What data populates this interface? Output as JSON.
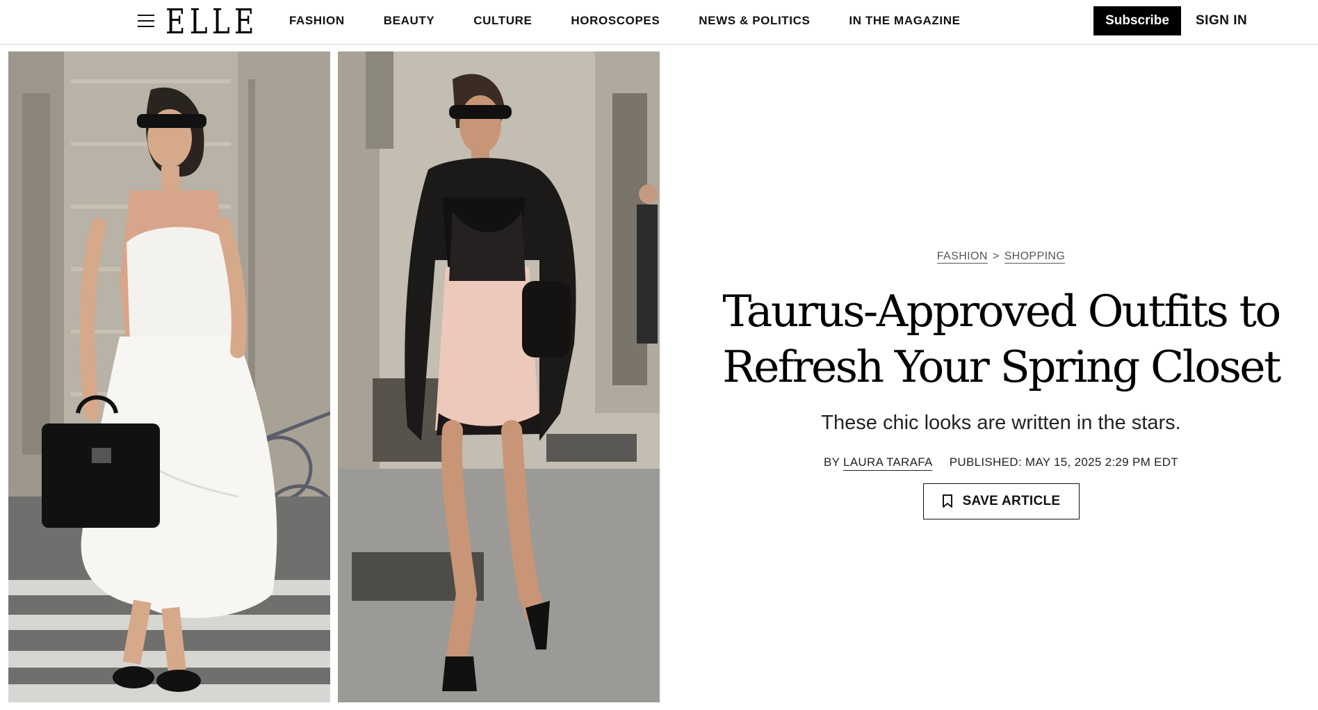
{
  "header": {
    "logo": "ELLE",
    "menu_icon": "hamburger-menu-icon",
    "nav": [
      {
        "label": "FASHION"
      },
      {
        "label": "BEAUTY"
      },
      {
        "label": "CULTURE"
      },
      {
        "label": "HOROSCOPES"
      },
      {
        "label": "NEWS & POLITICS"
      },
      {
        "label": "IN THE MAGAZINE"
      }
    ],
    "subscribe_label": "Subscribe",
    "signin_label": "SIGN IN"
  },
  "hero_images": {
    "left": "white-slip-dress-street-style-photo",
    "right": "leather-jacket-lace-slip-street-style-photo"
  },
  "article": {
    "breadcrumb": {
      "section": "FASHION",
      "separator": ">",
      "subsection": "SHOPPING"
    },
    "headline_line1": "Taurus-Approved Outfits to",
    "headline_line2": "Refresh Your Spring Closet",
    "dek": "These chic looks are written in the stars.",
    "byline_prefix": "BY",
    "author": "LAURA TARAFA",
    "published": "PUBLISHED: MAY 15, 2025 2:29 PM EDT",
    "save_label": "SAVE ARTICLE",
    "save_icon": "bookmark-icon"
  },
  "colors": {
    "text": "#111111",
    "subscribe_bg": "#000000",
    "border": "#cfcfcf"
  }
}
